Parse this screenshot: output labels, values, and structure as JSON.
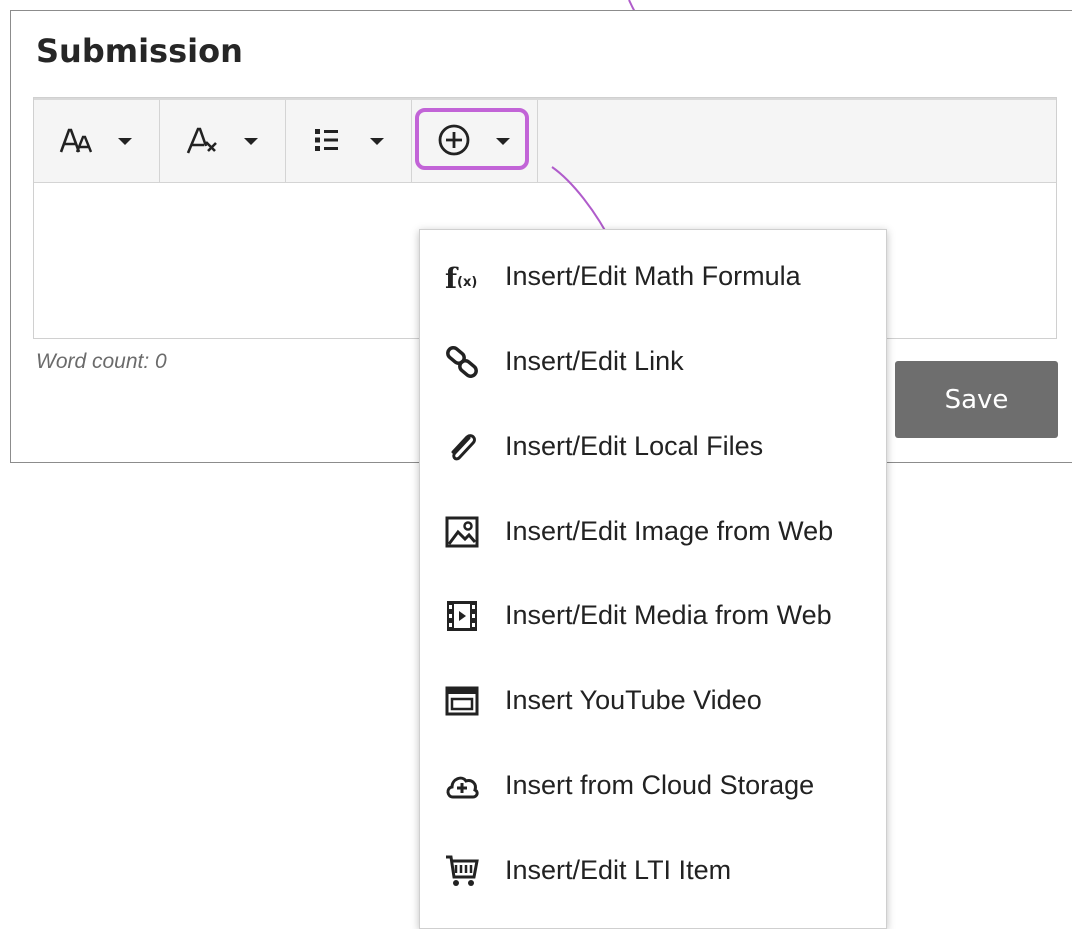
{
  "panel": {
    "title": "Submission",
    "word_count": "Word count: 0",
    "save_label": "Save"
  },
  "toolbar": {
    "buttons": [
      {
        "icon": "font-size-icon"
      },
      {
        "icon": "text-style-icon"
      },
      {
        "icon": "list-icon"
      },
      {
        "icon": "insert-content-icon",
        "highlighted": true
      }
    ]
  },
  "menu": {
    "items": [
      {
        "label": "Insert/Edit Math Formula",
        "icon": "math-formula-icon"
      },
      {
        "label": "Insert/Edit Link",
        "icon": "link-icon"
      },
      {
        "label": "Insert/Edit Local Files",
        "icon": "paperclip-icon"
      },
      {
        "label": "Insert/Edit Image from Web",
        "icon": "image-icon"
      },
      {
        "label": "Insert/Edit Media from Web",
        "icon": "film-icon"
      },
      {
        "label": "Insert YouTube Video",
        "icon": "video-embed-icon"
      },
      {
        "label": "Insert from Cloud Storage",
        "icon": "cloud-add-icon"
      },
      {
        "label": "Insert/Edit LTI Item",
        "icon": "cart-icon"
      }
    ]
  },
  "colors": {
    "highlight": "#c264d7",
    "save_button": "#6e6e6e"
  }
}
